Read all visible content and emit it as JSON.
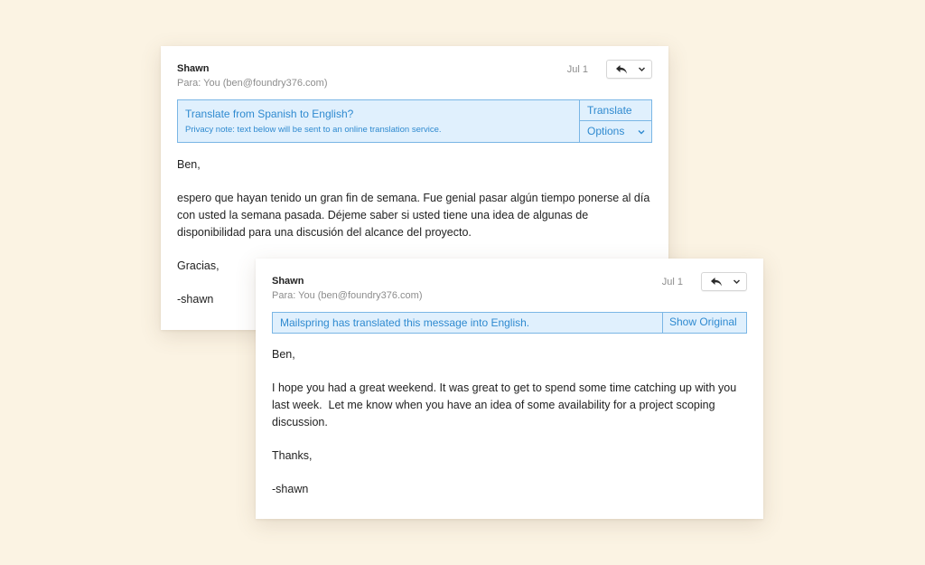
{
  "original_email": {
    "sender": "Shawn",
    "recipient": "Para: You (ben@foundry376.com)",
    "date": "Jul 1",
    "translate_banner": {
      "title": "Translate from Spanish to English?",
      "privacy_note": "Privacy note: text below will be sent to an online translation service.",
      "translate_button": "Translate",
      "options_button": "Options"
    },
    "greeting": "Ben,",
    "paragraph": "espero que hayan tenido un gran fin de semana. Fue genial pasar algún tiempo ponerse al día con usted la semana pasada. Déjeme saber si usted tiene una idea de algunas de disponibilidad para una discusión del alcance del proyecto.",
    "closing": "Gracias,",
    "signature": "-shawn"
  },
  "translated_email": {
    "sender": "Shawn",
    "recipient": "Para: You (ben@foundry376.com)",
    "date": "Jul 1",
    "translated_banner": {
      "message": "Mailspring has translated this message into English.",
      "show_original_button": "Show Original"
    },
    "greeting": "Ben,",
    "paragraph": "I hope you had a great weekend. It was great to get to spend some time catching up with you last week.  Let me know when you have an idea of some availability for a project scoping discussion.",
    "closing": "Thanks,",
    "signature": "-shawn"
  },
  "icons": {
    "reply": "reply-icon",
    "dropdown": "chevron-down-icon"
  },
  "colors": {
    "background": "#fbf3e3",
    "banner_background": "#e0f0fd",
    "banner_border": "#7ab6e5",
    "banner_text": "#2f8ad0"
  }
}
